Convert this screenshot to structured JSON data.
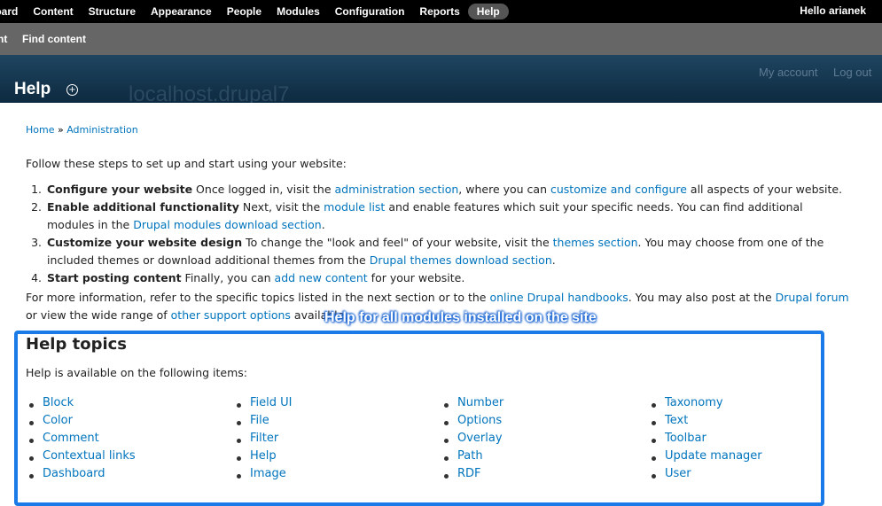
{
  "toolbar": {
    "items": [
      "board",
      "Content",
      "Structure",
      "Appearance",
      "People",
      "Modules",
      "Configuration",
      "Reports",
      "Help"
    ],
    "user": "Hello arianek"
  },
  "shortcuts": [
    "nt",
    "Find content"
  ],
  "branding": {
    "page_title": "Help",
    "site_name": "localhost.drupal7",
    "my_account": "My account",
    "log_out": "Log out"
  },
  "breadcrumb": {
    "home": "Home",
    "separator": " » ",
    "admin": "Administration"
  },
  "intro": "Follow these steps to set up and start using your website:",
  "steps": [
    {
      "num": "1.",
      "title": "Configure your website",
      "t1": " Once logged in, visit the ",
      "l1": "administration section",
      "t2": ", where you can ",
      "l2": "customize and configure",
      "t3": " all aspects of your website."
    },
    {
      "num": "2.",
      "title": "Enable additional functionality",
      "t1": " Next, visit the ",
      "l1": "module list",
      "t2": " and enable features which suit your specific needs. You can find additional modules in the ",
      "l2": "Drupal modules download section",
      "t3": "."
    },
    {
      "num": "3.",
      "title": "Customize your website design",
      "t1": " To change the \"look and feel\" of your website, visit the ",
      "l1": "themes section",
      "t2": ". You may choose from one of the included themes or download additional themes from the ",
      "l2": "Drupal themes download section",
      "t3": "."
    },
    {
      "num": "4.",
      "title": "Start posting content",
      "t1": " Finally, you can ",
      "l1": "add new content",
      "t2": " for your website.",
      "l2": "",
      "t3": ""
    }
  ],
  "more_info": {
    "t1": "For more information, refer to the specific topics listed in the next section or to the ",
    "l1": "online Drupal handbooks",
    "t2": ". You may also post at the ",
    "l2": "Drupal forum",
    "t3": " or view the wide range of ",
    "l3": "other support options",
    "t4": " available."
  },
  "annotation": "Help for all modules installed on the site",
  "help_topics": {
    "title": "Help topics",
    "subtitle": "Help is available on the following items:",
    "columns": [
      [
        "Block",
        "Color",
        "Comment",
        "Contextual links",
        "Dashboard"
      ],
      [
        "Field UI",
        "File",
        "Filter",
        "Help",
        "Image"
      ],
      [
        "Number",
        "Options",
        "Overlay",
        "Path",
        "RDF"
      ],
      [
        "Taxonomy",
        "Text",
        "Toolbar",
        "Update manager",
        "User"
      ]
    ]
  },
  "colors": {
    "link": "#0074bd",
    "annotation_border": "#1a7be8",
    "toolbar": "#000000",
    "shortcuts": "#666666"
  }
}
